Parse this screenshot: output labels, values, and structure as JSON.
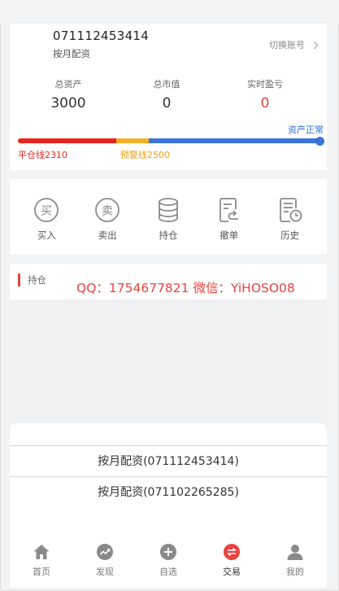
{
  "account": {
    "number": "071112453414",
    "type": "按月配资",
    "switch_label": "切换账号"
  },
  "stats": [
    {
      "label": "总资产",
      "value": "3000"
    },
    {
      "label": "总市值",
      "value": "0"
    },
    {
      "label": "实时盈亏",
      "value": "0"
    }
  ],
  "risk": {
    "status": "资产正常",
    "liquidation_line": "平仓线2310",
    "warning_line": "预警线2500"
  },
  "actions": [
    {
      "label": "买入",
      "icon": "buy-icon"
    },
    {
      "label": "卖出",
      "icon": "sell-icon"
    },
    {
      "label": "持仓",
      "icon": "database-stack-icon"
    },
    {
      "label": "撤单",
      "icon": "undo-document-icon"
    },
    {
      "label": "历史",
      "icon": "history-document-icon"
    }
  ],
  "positions": {
    "title": "持仓",
    "promo": "QQ：1754677821 微信：YiHOSO08"
  },
  "account_sheet": {
    "options": [
      "按月配资(071112453414)",
      "按月配资(071102265285)"
    ]
  },
  "tabs": [
    {
      "label": "首页",
      "icon": "home-icon"
    },
    {
      "label": "发现",
      "icon": "trend-icon"
    },
    {
      "label": "自选",
      "icon": "plus-circle-icon"
    },
    {
      "label": "交易",
      "icon": "exchange-icon",
      "active": true
    },
    {
      "label": "我的",
      "icon": "user-icon"
    }
  ],
  "colors": {
    "red": "#e8231f",
    "warning": "#f5b02a",
    "blue": "#3a73d9",
    "tab_active": "#e8433f",
    "tab_inactive": "#8a8a8a"
  }
}
